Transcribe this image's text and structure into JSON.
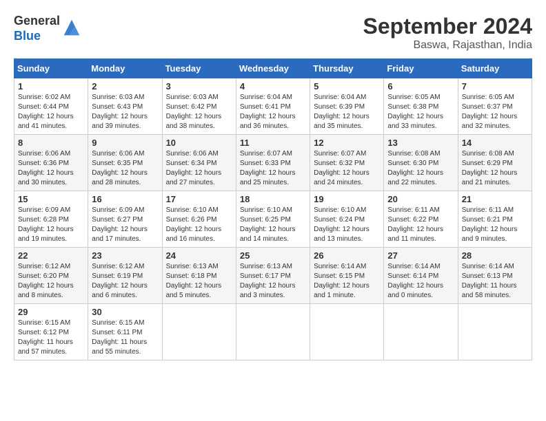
{
  "header": {
    "logo": {
      "text_general": "General",
      "text_blue": "Blue"
    },
    "title": "September 2024",
    "location": "Baswa, Rajasthan, India"
  },
  "calendar": {
    "days_of_week": [
      "Sunday",
      "Monday",
      "Tuesday",
      "Wednesday",
      "Thursday",
      "Friday",
      "Saturday"
    ],
    "weeks": [
      [
        {
          "day": "",
          "info": ""
        },
        {
          "day": "",
          "info": ""
        },
        {
          "day": "",
          "info": ""
        },
        {
          "day": "",
          "info": ""
        },
        {
          "day": "",
          "info": ""
        },
        {
          "day": "",
          "info": ""
        },
        {
          "day": "",
          "info": ""
        }
      ]
    ],
    "cells": [
      {
        "day": "1",
        "sunrise": "6:02 AM",
        "sunset": "6:44 PM",
        "daylight": "12 hours and 41 minutes."
      },
      {
        "day": "2",
        "sunrise": "6:03 AM",
        "sunset": "6:43 PM",
        "daylight": "12 hours and 39 minutes."
      },
      {
        "day": "3",
        "sunrise": "6:03 AM",
        "sunset": "6:42 PM",
        "daylight": "12 hours and 38 minutes."
      },
      {
        "day": "4",
        "sunrise": "6:04 AM",
        "sunset": "6:41 PM",
        "daylight": "12 hours and 36 minutes."
      },
      {
        "day": "5",
        "sunrise": "6:04 AM",
        "sunset": "6:39 PM",
        "daylight": "12 hours and 35 minutes."
      },
      {
        "day": "6",
        "sunrise": "6:05 AM",
        "sunset": "6:38 PM",
        "daylight": "12 hours and 33 minutes."
      },
      {
        "day": "7",
        "sunrise": "6:05 AM",
        "sunset": "6:37 PM",
        "daylight": "12 hours and 32 minutes."
      },
      {
        "day": "8",
        "sunrise": "6:06 AM",
        "sunset": "6:36 PM",
        "daylight": "12 hours and 30 minutes."
      },
      {
        "day": "9",
        "sunrise": "6:06 AM",
        "sunset": "6:35 PM",
        "daylight": "12 hours and 28 minutes."
      },
      {
        "day": "10",
        "sunrise": "6:06 AM",
        "sunset": "6:34 PM",
        "daylight": "12 hours and 27 minutes."
      },
      {
        "day": "11",
        "sunrise": "6:07 AM",
        "sunset": "6:33 PM",
        "daylight": "12 hours and 25 minutes."
      },
      {
        "day": "12",
        "sunrise": "6:07 AM",
        "sunset": "6:32 PM",
        "daylight": "12 hours and 24 minutes."
      },
      {
        "day": "13",
        "sunrise": "6:08 AM",
        "sunset": "6:30 PM",
        "daylight": "12 hours and 22 minutes."
      },
      {
        "day": "14",
        "sunrise": "6:08 AM",
        "sunset": "6:29 PM",
        "daylight": "12 hours and 21 minutes."
      },
      {
        "day": "15",
        "sunrise": "6:09 AM",
        "sunset": "6:28 PM",
        "daylight": "12 hours and 19 minutes."
      },
      {
        "day": "16",
        "sunrise": "6:09 AM",
        "sunset": "6:27 PM",
        "daylight": "12 hours and 17 minutes."
      },
      {
        "day": "17",
        "sunrise": "6:10 AM",
        "sunset": "6:26 PM",
        "daylight": "12 hours and 16 minutes."
      },
      {
        "day": "18",
        "sunrise": "6:10 AM",
        "sunset": "6:25 PM",
        "daylight": "12 hours and 14 minutes."
      },
      {
        "day": "19",
        "sunrise": "6:10 AM",
        "sunset": "6:24 PM",
        "daylight": "12 hours and 13 minutes."
      },
      {
        "day": "20",
        "sunrise": "6:11 AM",
        "sunset": "6:22 PM",
        "daylight": "12 hours and 11 minutes."
      },
      {
        "day": "21",
        "sunrise": "6:11 AM",
        "sunset": "6:21 PM",
        "daylight": "12 hours and 9 minutes."
      },
      {
        "day": "22",
        "sunrise": "6:12 AM",
        "sunset": "6:20 PM",
        "daylight": "12 hours and 8 minutes."
      },
      {
        "day": "23",
        "sunrise": "6:12 AM",
        "sunset": "6:19 PM",
        "daylight": "12 hours and 6 minutes."
      },
      {
        "day": "24",
        "sunrise": "6:13 AM",
        "sunset": "6:18 PM",
        "daylight": "12 hours and 5 minutes."
      },
      {
        "day": "25",
        "sunrise": "6:13 AM",
        "sunset": "6:17 PM",
        "daylight": "12 hours and 3 minutes."
      },
      {
        "day": "26",
        "sunrise": "6:14 AM",
        "sunset": "6:15 PM",
        "daylight": "12 hours and 1 minute."
      },
      {
        "day": "27",
        "sunrise": "6:14 AM",
        "sunset": "6:14 PM",
        "daylight": "12 hours and 0 minutes."
      },
      {
        "day": "28",
        "sunrise": "6:14 AM",
        "sunset": "6:13 PM",
        "daylight": "11 hours and 58 minutes."
      },
      {
        "day": "29",
        "sunrise": "6:15 AM",
        "sunset": "6:12 PM",
        "daylight": "11 hours and 57 minutes."
      },
      {
        "day": "30",
        "sunrise": "6:15 AM",
        "sunset": "6:11 PM",
        "daylight": "11 hours and 55 minutes."
      }
    ]
  }
}
